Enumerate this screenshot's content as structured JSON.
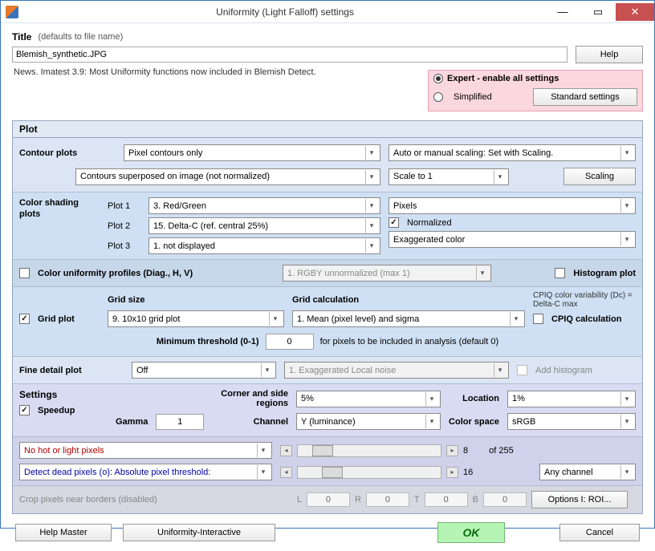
{
  "window": {
    "title": "Uniformity (Light Falloff) settings"
  },
  "title_section": {
    "label": "Title",
    "hint": "(defaults to file name)",
    "value": "Blemish_synthetic.JPG",
    "help_btn": "Help"
  },
  "news": "News. Imatest 3.9:  Most Uniformity functions now included in Blemish Detect.",
  "expert_box": {
    "expert": "Expert - enable all settings",
    "simplified": "Simplified",
    "std_btn": "Standard settings"
  },
  "plot_header": "Plot",
  "contour": {
    "label": "Contour plots",
    "sel1": "Pixel contours only",
    "sel2": "Contours superposed on image (not normalized)",
    "scaling_mode": "Auto or manual scaling: Set with Scaling.",
    "scale_to": "Scale to 1",
    "scaling_btn": "Scaling"
  },
  "color_shading": {
    "label": "Color shading plots",
    "plot1_lbl": "Plot 1",
    "plot1": "3.  Red/Green",
    "plot2_lbl": "Plot 2",
    "plot2": "15. Delta-C    (ref. central 25%)",
    "plot3_lbl": "Plot 3",
    "plot3": "1.  not displayed",
    "right1": "Pixels",
    "right2_chk": "Normalized",
    "right3": "Exaggerated color"
  },
  "uniformity_row": {
    "chk": "Color uniformity profiles (Diag., H, V)",
    "mid_sel": "1. RGBY unnormalized (max 1)",
    "hist_chk": "Histogram plot"
  },
  "grid": {
    "chk": "Grid plot",
    "size_lbl": "Grid size",
    "size_sel": "9.  10x10 grid plot",
    "calc_lbl": "Grid calculation",
    "calc_sel": "1. Mean (pixel level) and sigma",
    "cpiq_note": "CPIQ color variability (Dc) = Delta-C max",
    "cpiq_chk": "CPIQ calculation",
    "min_lbl": "Minimum threshold (0-1)",
    "min_val": "0",
    "min_hint": "for pixels to be included in analysis (default 0)"
  },
  "fine_detail": {
    "label": "Fine detail plot",
    "sel1": "Off",
    "sel2": "1.  Exaggerated Local noise",
    "chk": "Add histogram"
  },
  "settings": {
    "label": "Settings",
    "speedup": "Speedup",
    "corner_lbl": "Corner and side regions",
    "corner_sel": "5%",
    "location_lbl": "Location",
    "location_sel": "1%",
    "gamma_lbl": "Gamma",
    "gamma_val": "1",
    "channel_lbl": "Channel",
    "channel_sel": "Y (luminance)",
    "cspace_lbl": "Color space",
    "cspace_sel": "sRGB"
  },
  "pixel_detect": {
    "hot_sel": "No hot or light pixels",
    "dead_sel": "Detect dead pixels (o):  Absolute pixel threshold:",
    "val1": "8",
    "of": "of 255",
    "val2": "16",
    "any_channel": "Any channel"
  },
  "crop": {
    "label": "Crop pixels near borders (disabled)",
    "L": "L",
    "R": "R",
    "T": "T",
    "B": "B",
    "v": "0",
    "options_btn": "Options I: ROI..."
  },
  "bottom": {
    "help_master": "Help Master",
    "uniformity_interactive": "Uniformity-Interactive",
    "ok": "OK",
    "cancel": "Cancel"
  }
}
